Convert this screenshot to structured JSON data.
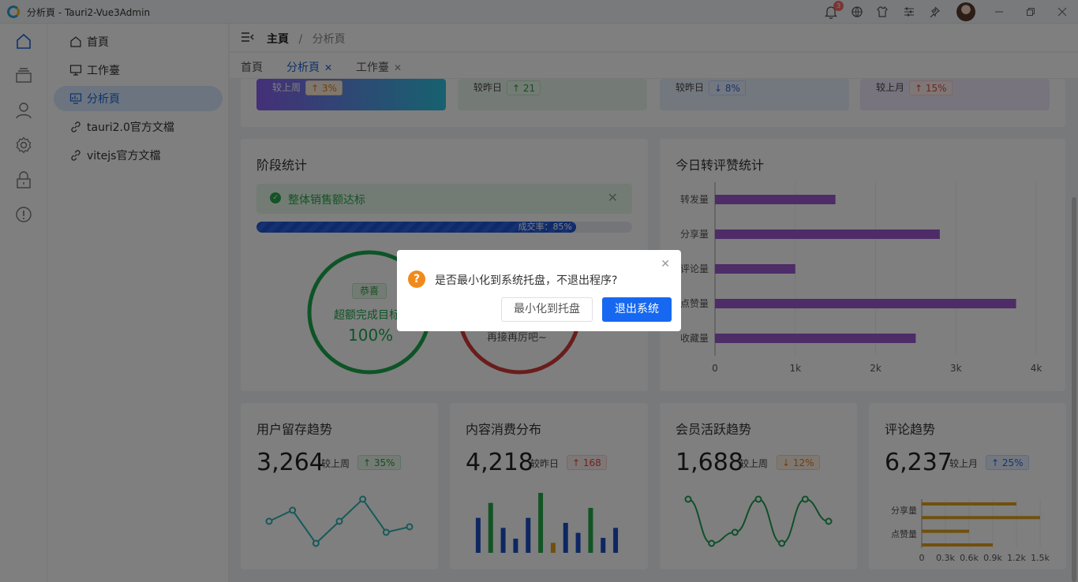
{
  "window": {
    "title": "分析頁 - Tauri2-Vue3Admin",
    "notification_count": "3"
  },
  "menu": {
    "items": [
      {
        "label": "首頁",
        "icon": "home-icon"
      },
      {
        "label": "工作臺",
        "icon": "monitor-icon"
      },
      {
        "label": "分析頁",
        "icon": "chart-icon"
      },
      {
        "label": "tauri2.0官方文檔",
        "icon": "link-icon"
      },
      {
        "label": "vitejs官方文檔",
        "icon": "link-icon"
      }
    ],
    "active_index": 2
  },
  "breadcrumb": {
    "root": "主頁",
    "sep": "/",
    "current": "分析頁"
  },
  "tabs": [
    {
      "label": "首頁",
      "closable": false
    },
    {
      "label": "分析頁",
      "closable": true
    },
    {
      "label": "工作臺",
      "closable": true
    }
  ],
  "top_cards": [
    {
      "cmp": "较上周",
      "delta": "↑ 3%"
    },
    {
      "cmp": "较昨日",
      "delta": "↑ 21"
    },
    {
      "cmp": "较昨日",
      "delta": "↓ 8%"
    },
    {
      "cmp": "较上月",
      "delta": "↑ 15%"
    }
  ],
  "stage": {
    "title": "阶段统计",
    "alert": "整体销售额达标",
    "progress_label": "成交率：85%",
    "progress": 0.85,
    "ring1": {
      "tag": "恭喜",
      "text": "超额完成目标",
      "value": "100%"
    },
    "ring2": {
      "text": "再接再厉吧~"
    }
  },
  "today": {
    "title": "今日转评赞统计",
    "chart_data": {
      "type": "bar",
      "orientation": "horizontal",
      "categories": [
        "转发量",
        "分享量",
        "评论量",
        "点赞量",
        "收藏量"
      ],
      "values": [
        1500,
        2800,
        1000,
        3750,
        2500
      ],
      "xlim": [
        0,
        4000
      ],
      "xticks": [
        "0",
        "1k",
        "2k",
        "3k",
        "4k"
      ],
      "color": "#9b59d0"
    }
  },
  "bottom": [
    {
      "title": "用户留存趋势",
      "value": "3,264",
      "cmp": "较上周",
      "delta": "↑ 35%",
      "chart_data": {
        "type": "line",
        "values": [
          2,
          3,
          0,
          2,
          4,
          1,
          1.5
        ],
        "color": "#2fb3b3"
      }
    },
    {
      "title": "内容消费分布",
      "value": "4,218",
      "cmp": "较昨日",
      "delta": "↑ 168",
      "chart_data": {
        "type": "bar",
        "values": [
          42,
          60,
          30,
          17,
          42,
          72,
          12,
          36,
          24,
          54,
          18,
          30
        ],
        "colors": [
          "#1d4fc4",
          "#27a84a",
          "#1d4fc4",
          "#1d4fc4",
          "#1d4fc4",
          "#27a84a",
          "#e0a11a",
          "#1d4fc4",
          "#1d4fc4",
          "#27a84a",
          "#1d4fc4",
          "#1d4fc4"
        ]
      }
    },
    {
      "title": "会员活跃趋势",
      "value": "1,688",
      "cmp": "较上周",
      "delta": "↓ 12%",
      "chart_data": {
        "type": "line",
        "smooth": true,
        "values": [
          4,
          0,
          1,
          4,
          0,
          4,
          2
        ],
        "color": "#1e9e55"
      }
    },
    {
      "title": "评论趋势",
      "value": "6,237",
      "cmp": "较上月",
      "delta": "↑ 25%",
      "chart_data": {
        "type": "bar",
        "orientation": "horizontal",
        "categories": [
          "分享量",
          "点赞量"
        ],
        "values": [
          1200,
          1500,
          600,
          900
        ],
        "xticks": [
          "0",
          "0.3k",
          "0.6k",
          "0.9k",
          "1.2k",
          "1.5k"
        ],
        "xlim": [
          0,
          1500
        ],
        "color": "#e0a11a"
      }
    }
  ],
  "dialog": {
    "message": "是否最小化到系统托盘，不退出程序?",
    "cancel_label": "最小化到托盘",
    "confirm_label": "退出系统"
  }
}
